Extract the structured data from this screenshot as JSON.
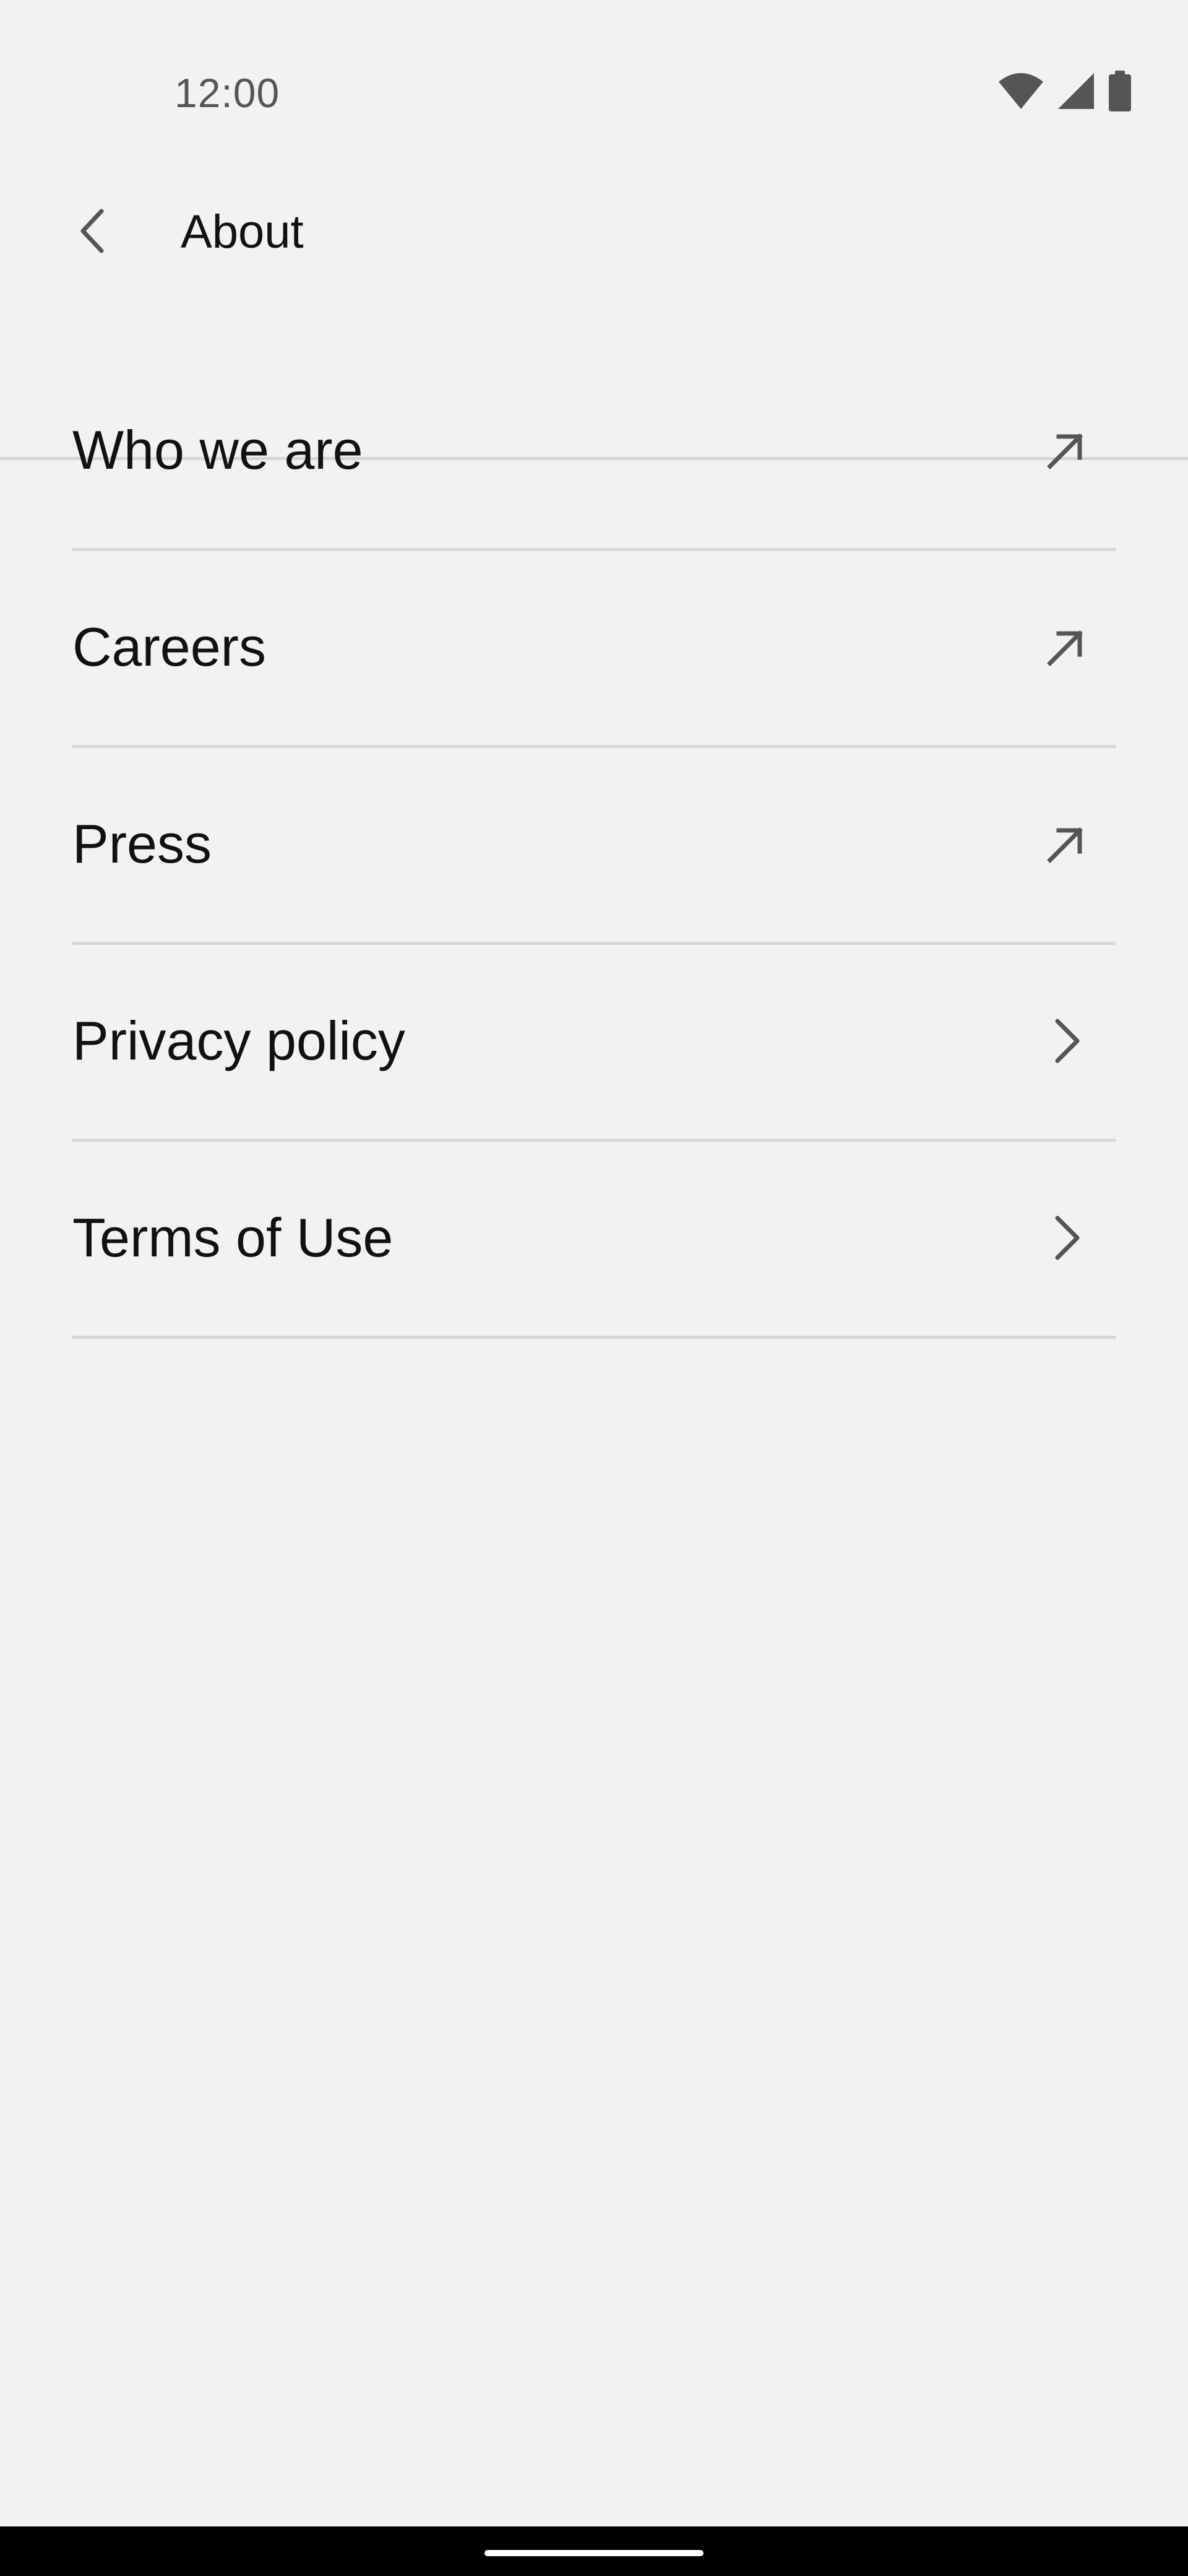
{
  "status_bar": {
    "time": "12:00",
    "icons": [
      "wifi-icon",
      "signal-icon",
      "battery-icon"
    ]
  },
  "app_bar": {
    "back_icon": "chevron-left-icon",
    "title": "About"
  },
  "menu": {
    "items": [
      {
        "label": "Who we are",
        "icon": "external-link-arrow-icon"
      },
      {
        "label": "Careers",
        "icon": "external-link-arrow-icon"
      },
      {
        "label": "Press",
        "icon": "external-link-arrow-icon"
      },
      {
        "label": "Privacy policy",
        "icon": "chevron-right-icon"
      },
      {
        "label": "Terms of Use",
        "icon": "chevron-right-icon"
      }
    ]
  },
  "colors": {
    "background": "#f2f2f2",
    "text": "#111111",
    "icon": "#555555",
    "divider": "#d6d6d6",
    "nav_bar": "#000000"
  }
}
